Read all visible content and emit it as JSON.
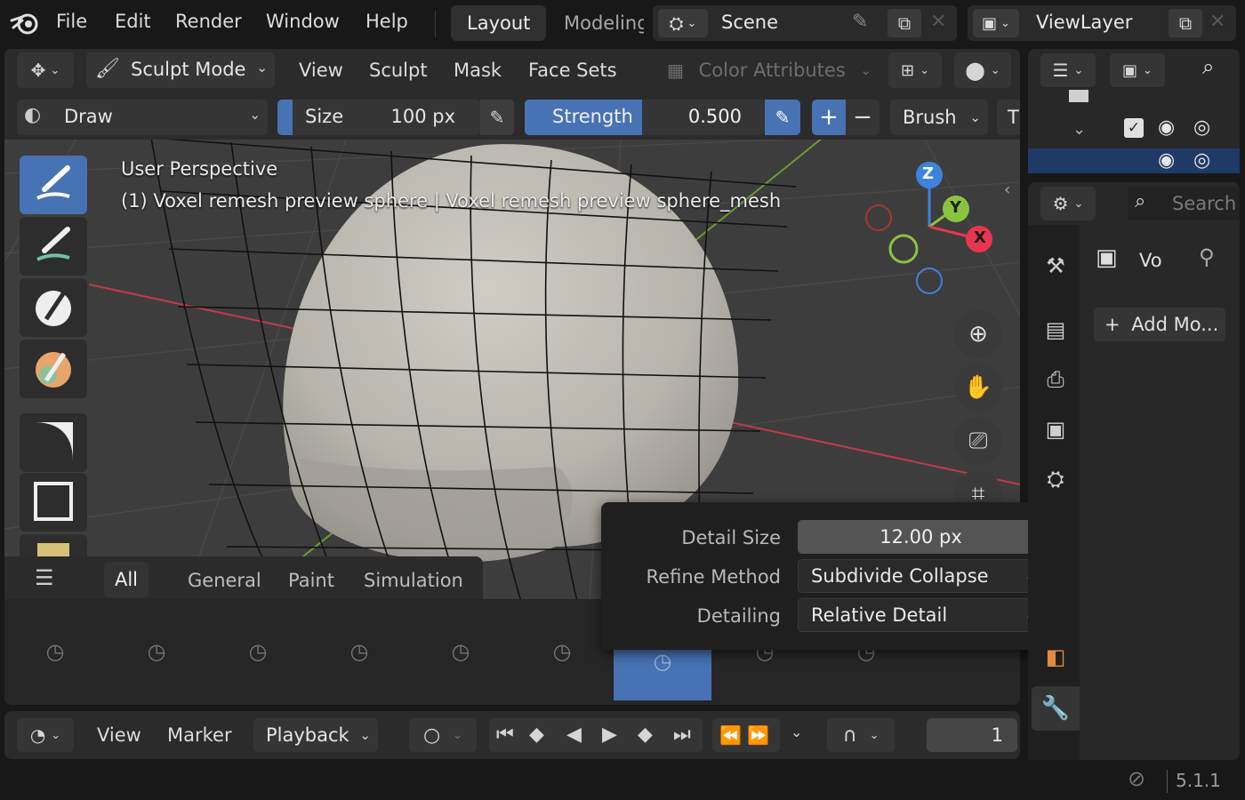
{
  "topbar": {
    "menus": [
      "File",
      "Edit",
      "Render",
      "Window",
      "Help"
    ],
    "workspaces": [
      "Layout",
      "Modeling"
    ],
    "scene": "Scene",
    "view_layer": "ViewLayer"
  },
  "viewport_header": {
    "mode": "Sculpt Mode",
    "menus": [
      "View",
      "Sculpt",
      "Mask",
      "Face Sets"
    ],
    "color_attributes": "Color Attributes"
  },
  "tool_settings": {
    "brush_name": "Draw",
    "size_label": "Size",
    "size_value": "100 px",
    "strength_label": "Strength",
    "strength_value": "0.500",
    "plus": "+",
    "minus": "−",
    "brush_menu": "Brush",
    "overflow": "T"
  },
  "viewport": {
    "view_name": "User Perspective",
    "object_info": "(1) Voxel remesh preview sphere | Voxel remesh preview sphere_mesh",
    "axes": {
      "x": "X",
      "y": "Y",
      "z": "Z"
    },
    "colors": {
      "x": "#e8364f",
      "y": "#8ac33f",
      "z": "#3c83e0"
    }
  },
  "asset_shelf": {
    "tabs": [
      "All",
      "General",
      "Paint",
      "Simulation"
    ],
    "active_tab": "All"
  },
  "popover": {
    "detail_size_label": "Detail Size",
    "detail_size_value": "12.00 px",
    "refine_label": "Refine Method",
    "refine_value": "Subdivide Collapse",
    "detailing_label": "Detailing",
    "detailing_value": "Relative Detail"
  },
  "properties": {
    "search_placeholder": "Search",
    "object_short": "Vo",
    "add_modifier": "Add Mo..."
  },
  "timeline": {
    "view": "View",
    "marker": "Marker",
    "playback": "Playback",
    "frame": "1"
  },
  "statusbar": {
    "version": "5.1.1"
  }
}
